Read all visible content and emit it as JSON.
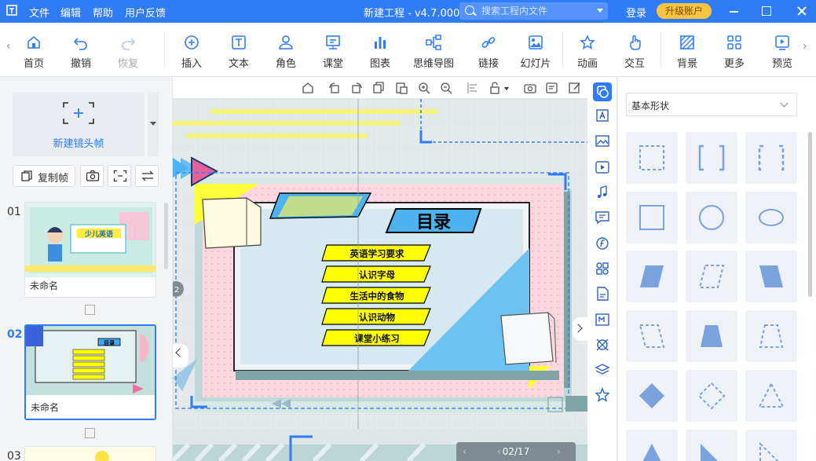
{
  "app": {
    "logo": "뫂",
    "menu": [
      "文件",
      "编辑",
      "帮助",
      "用户反馈"
    ],
    "title": "新建工程 - v4.7.000"
  },
  "search": {
    "placeholder": "搜索工程内文件"
  },
  "account": {
    "login": "登录",
    "upgrade": "升级账户"
  },
  "toolbar": {
    "items": [
      "首页",
      "撤销",
      "恢复",
      "插入",
      "文本",
      "角色",
      "课堂",
      "图表",
      "思维导图",
      "链接",
      "幻灯片",
      "动画",
      "交互",
      "背景",
      "更多",
      "预览"
    ]
  },
  "left": {
    "new_frame": "新建镜头帧",
    "copy_frame": "复制帧",
    "slides": [
      {
        "num": "01",
        "name": "未命名",
        "thumb_title": "少儿英语"
      },
      {
        "num": "02",
        "name": "未命名",
        "thumb_title": "目录"
      },
      {
        "num": "03"
      }
    ]
  },
  "slide": {
    "title": "目录",
    "items": [
      "英语学习要求",
      "认识字母",
      "生活中的食物",
      "认识动物",
      "课堂小练习"
    ],
    "page_badge": "2"
  },
  "pager": {
    "label": "02/17"
  },
  "right_panel": {
    "select_value": "基本形状"
  },
  "colors": {
    "accent": "#2f7cf6",
    "upgrade": "#f6c343",
    "slide_yellow": "#ffff00",
    "slide_blue": "#4db3f0"
  }
}
